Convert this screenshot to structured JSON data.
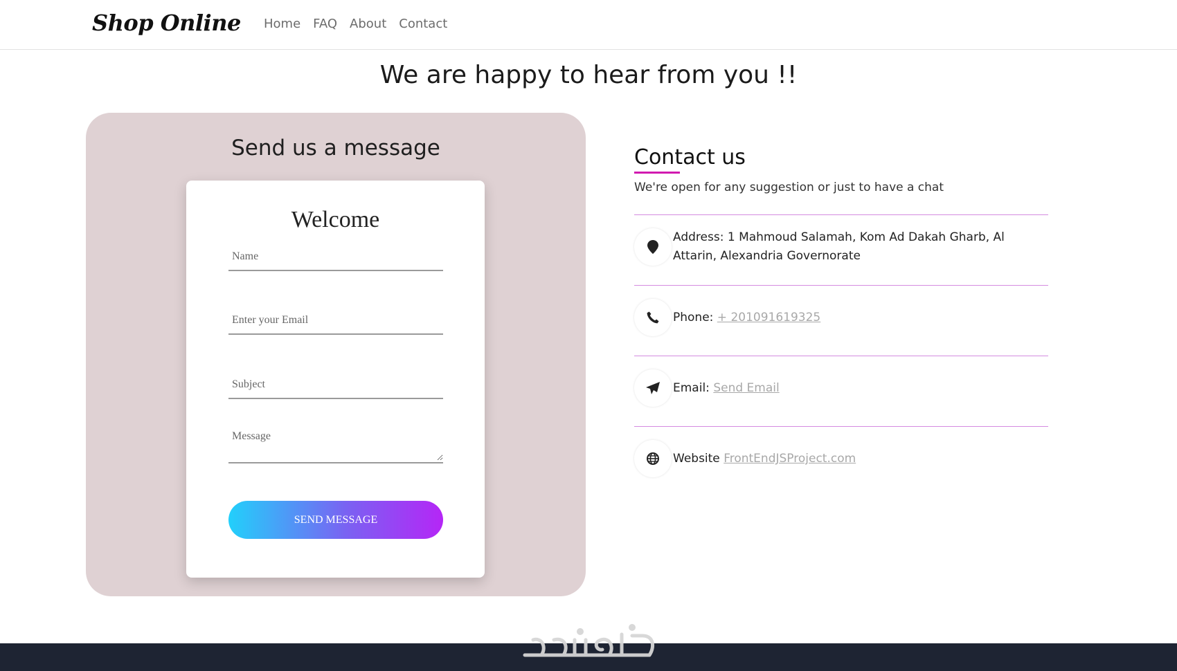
{
  "navbar": {
    "brand": "Shop Online",
    "links": [
      "Home",
      "FAQ",
      "About",
      "Contact"
    ]
  },
  "heading": "We are happy to hear from you !!",
  "message_panel": {
    "title": "Send us a message",
    "form": {
      "welcome": "Welcome",
      "name_placeholder": "Name",
      "email_placeholder": "Enter your Email",
      "subject_placeholder": "Subject",
      "message_placeholder": "Message",
      "submit_label": "SEND MESSAGE"
    }
  },
  "contact": {
    "title": "Contact us",
    "subtitle": "We're open for any suggestion or just to have a chat",
    "address_label": "Address:",
    "address_value": "1 Mahmoud Salamah, Kom Ad Dakah Gharb, Al Attarin, Alexandria Governorate",
    "phone_label": "Phone:",
    "phone_value": "+ 201091619325",
    "email_label": "Email:",
    "email_value": "Send Email",
    "website_label": "Website",
    "website_value": "FrontEndJSProject.com"
  },
  "icons": {
    "address": "map-pin-icon",
    "phone": "phone-icon",
    "email": "paper-plane-icon",
    "website": "globe-icon"
  },
  "colors": {
    "panel_bg": "#dfd1d3",
    "accent": "#d11ab0",
    "button_start": "#22d0fb",
    "button_end": "#b526f6",
    "footer_bg": "#1e2433"
  }
}
